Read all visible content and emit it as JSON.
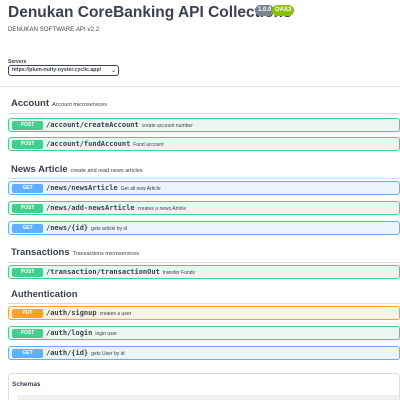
{
  "header": {
    "title": "Denukan CoreBanking API Collections",
    "version_badge": "1.0.0",
    "oas_badge": "OAS3",
    "subtitle": "DENUKAN SOFTWARE API v2.2"
  },
  "servers": {
    "label": "Servers",
    "selected": "https://plum-nutty-oyster.cyclic.app/"
  },
  "sections": [
    {
      "name": "Account",
      "description": "Account microservices",
      "operations": [
        {
          "method": "POST",
          "path": "/account/createAccount",
          "summary": "create account number"
        },
        {
          "method": "POST",
          "path": "/account/fundAccount",
          "summary": "Fund account"
        }
      ]
    },
    {
      "name": "News Article",
      "description": "create and read news articles",
      "operations": [
        {
          "method": "GET",
          "path": "/news/newsArticle",
          "summary": "Get all new Article"
        },
        {
          "method": "POST",
          "path": "/news/add-newsArticle",
          "summary": "creates a news Article"
        },
        {
          "method": "GET",
          "path": "/news/{id}",
          "summary": "gets article by id"
        }
      ]
    },
    {
      "name": "Transactions",
      "description": "Transactions microservices",
      "operations": [
        {
          "method": "POST",
          "path": "/transaction/transactionOut",
          "summary": "transfer Funds"
        }
      ]
    },
    {
      "name": "Authentication",
      "description": "",
      "operations": [
        {
          "method": "PUT",
          "path": "/auth/signup",
          "summary": "creates a user"
        },
        {
          "method": "POST",
          "path": "/auth/login",
          "summary": "login user"
        },
        {
          "method": "GET",
          "path": "/auth/{id}",
          "summary": "gets User by id"
        }
      ]
    }
  ],
  "schemas": {
    "title": "Schemas"
  },
  "colors": {
    "post": "#49cc90",
    "get": "#61affe",
    "put": "#fca130"
  }
}
